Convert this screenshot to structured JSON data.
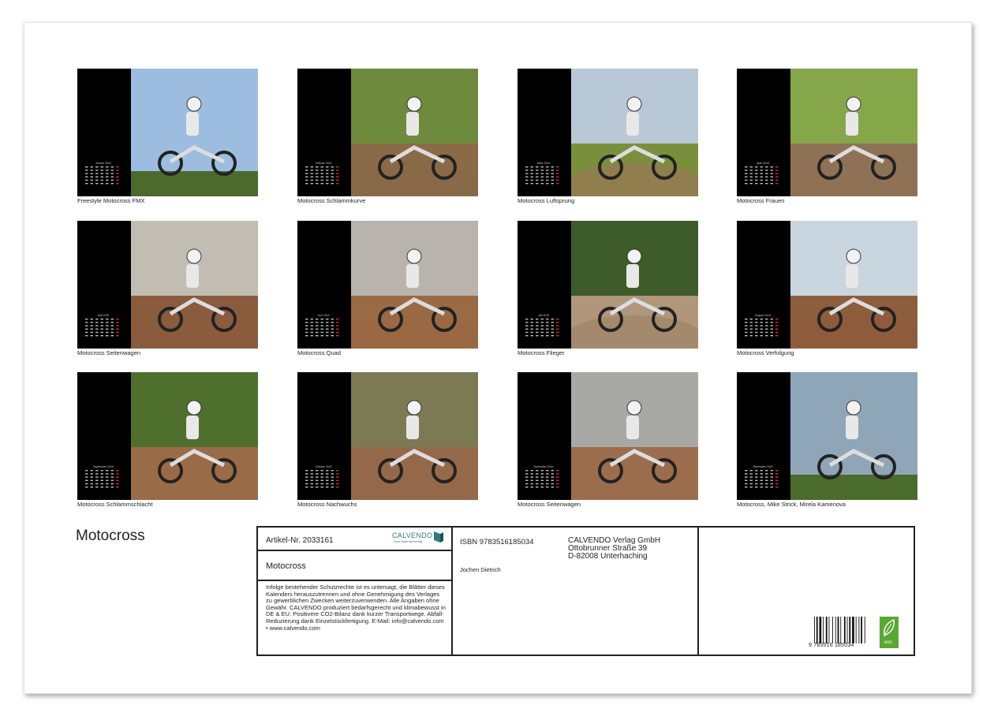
{
  "months": [
    {
      "caption": "Freestyle Motocross FMX",
      "calendar_label": "Januar 2016"
    },
    {
      "caption": "Motocross Schlammkurve",
      "calendar_label": "Februar 2016"
    },
    {
      "caption": "Motocross Luftsprung",
      "calendar_label": "März 2016"
    },
    {
      "caption": "Motocross Frauen",
      "calendar_label": "April 2016"
    },
    {
      "caption": "Motocross Seitenwagen",
      "calendar_label": "Mai 2016"
    },
    {
      "caption": "Motocross Quad",
      "calendar_label": "Juni 2016"
    },
    {
      "caption": "Motocross Flieger",
      "calendar_label": "Juli 2016"
    },
    {
      "caption": "Motocross Verfolgung",
      "calendar_label": "August 2016"
    },
    {
      "caption": "Motocross Schlammschlacht",
      "calendar_label": "September 2016"
    },
    {
      "caption": "Motocross Nachwuchs",
      "calendar_label": "Oktober 2016"
    },
    {
      "caption": "Motocross Seitenwagen",
      "calendar_label": "November 2016"
    },
    {
      "caption": "Motocross, Mike Strick, Mirela Kamenova",
      "calendar_label": "Dezember 2016"
    }
  ],
  "calendar_title": "Motocross",
  "info": {
    "article": "Artikel-Nr. 2033161",
    "brand": "CALVENDO",
    "brand_tagline": "Dein Kalenderverlag",
    "title": "Motocross",
    "legal": "Infolge bestehender Schutzrechte ist es untersagt, die Blätter dieses Kalenders herauszutrennen und ohne Genehmigung des Verlages zu gewerblichen Zwecken weiterzuverwenden. Alle Angaben ohne Gewähr. CALVENDO produziert bedarfsgerecht und klimabewusst in DE & EU. Positivere CO2-Bilanz dank kurzer Transportwege. Abfall-Reduzierung dank Einzelstückfertigung. E-Mail: info@calvendo.com • www.calvendo.com",
    "isbn": "ISBN 9783516185034",
    "author": "Jochen Dietrich",
    "publisher_name": "CALVENDO Verlag GmbH",
    "publisher_street": "Ottobrunner Straße 39",
    "publisher_city": "D-82008 Unterhaching",
    "barcode_text": "9 783516 185034",
    "eco_label": "eco"
  },
  "colors": {
    "accent": "#2e7d7a",
    "eco_green": "#5aa832",
    "tile_bg": "#000000"
  }
}
